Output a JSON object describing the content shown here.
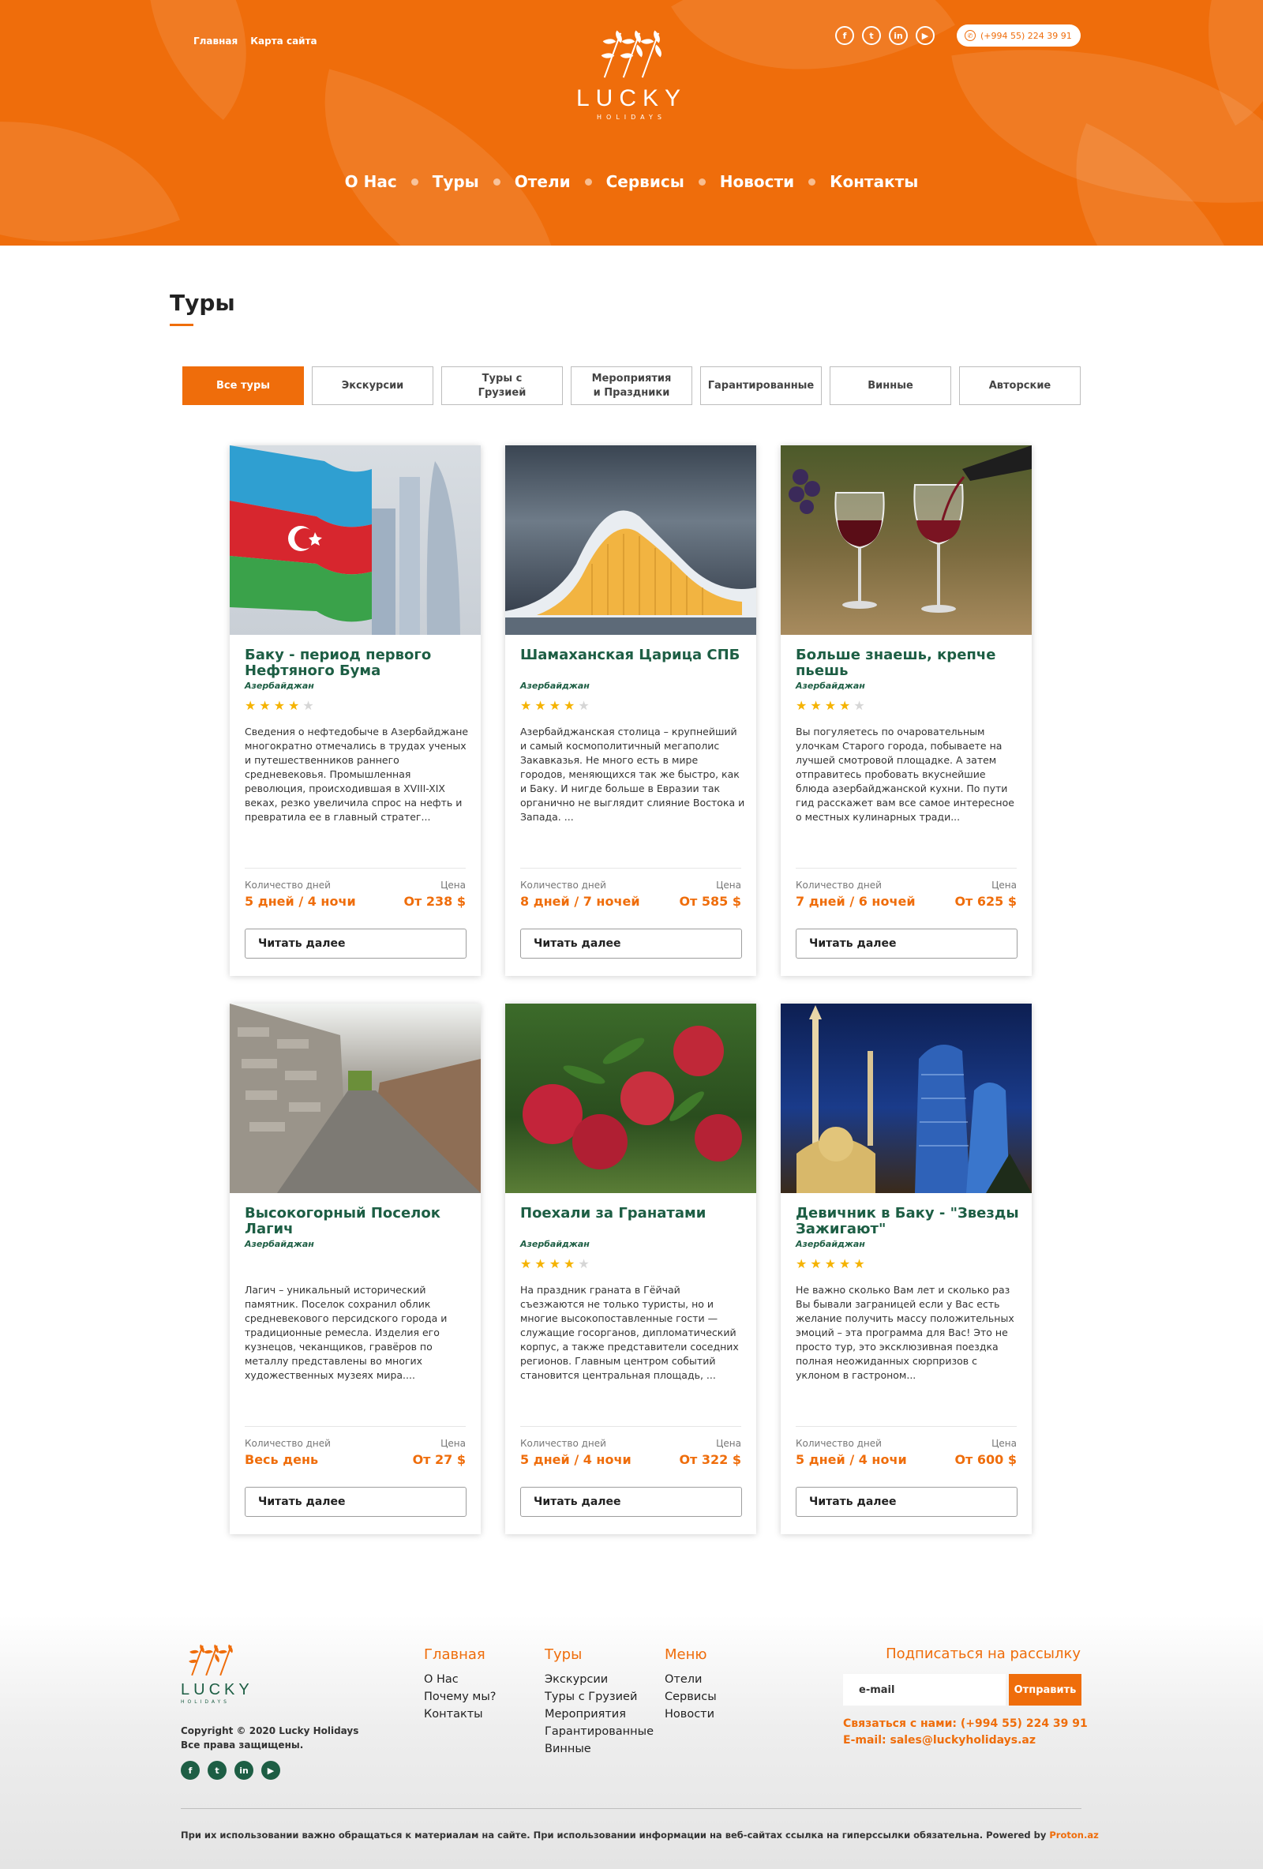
{
  "header": {
    "top_links": [
      "Главная",
      "Карта сайта"
    ],
    "logo": {
      "brand": "LUCKY",
      "sub": "HOLIDAYS"
    },
    "socials": [
      "f",
      "t",
      "in",
      "▶"
    ],
    "phone": "(+994 55) 224 39 91",
    "nav": [
      "О Нас",
      "Туры",
      "Отели",
      "Сервисы",
      "Новости",
      "Контакты"
    ]
  },
  "page": {
    "title": "Туры"
  },
  "filters": [
    "Все туры",
    "Экскурсии",
    "Туры с\nГрузией",
    "Мероприятия\nи Праздники",
    "Гарантированные",
    "Винные",
    "Авторские"
  ],
  "card_labels": {
    "days": "Количество дней",
    "price": "Цена",
    "more": "Читать далее"
  },
  "tours": [
    {
      "title": "Баку - период первого Нефтяного Бума",
      "country": "Азербайджан",
      "rating": 4,
      "description": "Сведения о нефтедобыче в Азербайджане многократно отмечались в трудах ученых и путешественников раннего средневековья. Промышленная революция, происходившая в XVIII-XIX веках, резко увеличила спрос на нефть и превратила ее в главный стратег...",
      "duration": "5 дней / 4 ночи",
      "price": "От 238 $"
    },
    {
      "title": "Шамаханская Царица СПБ",
      "country": "Азербайджан",
      "rating": 4,
      "description": "Азербайджанская столица – крупнейший и самый космополитичный мегаполис Закавказья. Не много есть в мире городов, меняющихся так же быстро, как и Баку. И нигде больше в Евразии так органично не выглядит слияние Востока и Запада. ...",
      "duration": "8 дней / 7 ночей",
      "price": "От 585 $"
    },
    {
      "title": "Больше знаешь, крепче пьешь",
      "country": "Азербайджан",
      "rating": 4,
      "description": "Вы погуляетесь по очаровательным улочкам Старого города, побываете на лучшей смотровой площадке. А затем отправитесь пробовать вкуснейшие блюда азербайджанской кухни. По пути гид расскажет вам все самое интересное о местных кулинарных тради...",
      "duration": "7 дней / 6 ночей",
      "price": "От 625 $"
    },
    {
      "title": "Высокогорный Поселок Лагич",
      "country": "Азербайджан",
      "rating": 0,
      "description": "Лагич – уникальный исторический памятник. Поселок сохранил облик средневекового персидского города и традиционные ремесла. Изделия его кузнецов, чеканщиков, гравёров по металлу представлены во многих художественных музеях мира....",
      "duration": "Весь день",
      "price": "От 27 $"
    },
    {
      "title": "Поехали за Гранатами",
      "country": "Азербайджан",
      "rating": 4,
      "description": "На праздник граната в Гёйчай съезжаются не только туристы, но и многие высокопоставленные гости — служащие госорганов, дипломатический корпус, а также представители соседних регионов. Главным центром событий становится центральная площадь, ...",
      "duration": "5 дней / 4 ночи",
      "price": "От 322 $"
    },
    {
      "title": "Девичник в Баку - \"Звезды Зажигают\"",
      "country": "Азербайджан",
      "rating": 5,
      "description": "Не важно сколько Вам лет и сколько раз Вы бывали заграницей если у Вас есть желание получить массу положительных эмоций – эта программа для Вас! Это не просто тур, это эксклюзивная поездка полная неожиданных сюрпризов с уклоном в гастроном...",
      "duration": "5 дней / 4 ночи",
      "price": "От 600 $"
    }
  ],
  "footer": {
    "logo": {
      "brand": "LUCKY",
      "sub": "HOLIDAYS"
    },
    "copyright_line1": "Copyright © 2020 Lucky Holidays",
    "copyright_line2": "Все права защищены.",
    "socials": [
      "f",
      "t",
      "in",
      "▶"
    ],
    "columns": [
      {
        "heading": "Главная",
        "items": [
          "О Нас",
          "Почему мы?",
          "Контакты"
        ]
      },
      {
        "heading": "Туры",
        "items": [
          "Экскурсии",
          "Туры с Грузией",
          "Мероприятия",
          "Гарантированные",
          "Винные"
        ]
      },
      {
        "heading": "Меню",
        "items": [
          "Отели",
          "Сервисы",
          "Новости"
        ]
      }
    ],
    "subscribe_title": "Подписаться на рассылку",
    "email_placeholder": "e-mail",
    "send_label": "Отправить",
    "contact_phone": "Связаться с нами: (+994 55) 224 39 91",
    "contact_email": "E-mail: sales@luckyholidays.az",
    "disclaimer": "При их использовании важно обращаться к материалам на сайте. При использовании информации на веб-сайтах ссылка на гиперссылки обязательна. Powered by ",
    "powered_link": "Proton.az"
  },
  "colors": {
    "accent": "#ef6d0b",
    "green": "#1d5e44",
    "star": "#f5b301"
  }
}
